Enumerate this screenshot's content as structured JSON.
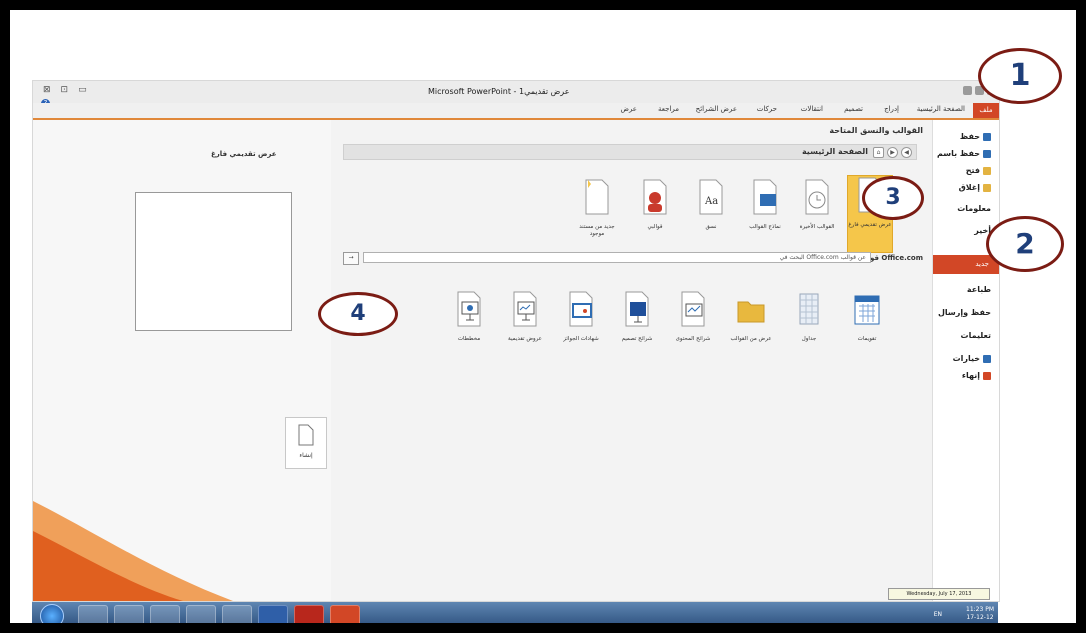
{
  "window": {
    "title": "Microsoft PowerPoint - عرض تقديمي1",
    "help_glyph": "?",
    "tabs": [
      "ملف",
      "الصفحة الرئيسية",
      "إدراج",
      "تصميم",
      "انتقالات",
      "حركات",
      "عرض الشرائح",
      "مراجعة",
      "عرض"
    ]
  },
  "backstage_nav": {
    "items": [
      {
        "label": "حفظ",
        "icon": "save-icon",
        "color": "#2f6db3"
      },
      {
        "label": "حفظ باسم",
        "icon": "save-as-icon",
        "color": "#2f6db3"
      },
      {
        "label": "فتح",
        "icon": "open-folder-icon",
        "color": "#e3b341"
      },
      {
        "label": "إغلاق",
        "icon": "close-file-icon",
        "color": "#e3b341"
      },
      {
        "label": "معلومات",
        "icon": "",
        "color": ""
      },
      {
        "label": "أخير",
        "icon": "",
        "color": ""
      },
      {
        "label": "جديد",
        "icon": "",
        "color": "#d24726"
      },
      {
        "label": "طباعة",
        "icon": "",
        "color": ""
      },
      {
        "label": "حفظ وإرسال",
        "icon": "",
        "color": ""
      },
      {
        "label": "تعليمات",
        "icon": "",
        "color": ""
      },
      {
        "label": "خيارات",
        "icon": "options-icon",
        "color": "#2f6db3"
      },
      {
        "label": "إنهاء",
        "icon": "exit-icon",
        "color": "#d24726"
      }
    ]
  },
  "center": {
    "title": "القوالب والنسق المتاحة",
    "home_label": "الصفحة الرئيسية",
    "templates": [
      {
        "label": "عرض تقديمي فارغ",
        "selected": true
      },
      {
        "label": "القوالب الأخيرة",
        "selected": false
      },
      {
        "label": "نماذج القوالب",
        "selected": false
      },
      {
        "label": "نسق",
        "selected": false
      },
      {
        "label": "قوالبي",
        "selected": false
      },
      {
        "label": "جديد من مستند موجود",
        "selected": false
      }
    ],
    "office_label": "قوالب Office.com",
    "search_placeholder": "البحث في Office.com عن قوالب",
    "search_button": "→",
    "office_templates": [
      {
        "label": "تقويمات"
      },
      {
        "label": "جداول"
      },
      {
        "label": "عرض من القوالب"
      },
      {
        "label": "شرائح المحتوى"
      },
      {
        "label": "شرائح تصميم"
      },
      {
        "label": "شهادات الجوائز"
      },
      {
        "label": "عروض تقديمية"
      },
      {
        "label": "مخططات"
      }
    ]
  },
  "preview": {
    "title": "عرض تقديمي فارغ",
    "create_label": "إنشاء"
  },
  "taskbar": {
    "apps": [
      "start",
      "explorer",
      "media-player",
      "internet-explorer",
      "firefox",
      "chrome",
      "word",
      "acrobat",
      "powerpoint"
    ],
    "lang": "EN",
    "time": "11:23 PM",
    "date": "17-12-12",
    "date_tooltip": "Wednesday, July 17, 2013"
  },
  "callouts": [
    "1",
    "2",
    "3",
    "4"
  ],
  "colors": {
    "accent": "#d24726",
    "selected_tile": "#f5c64a",
    "callout_border": "#7b1c14",
    "callout_text": "#1f3f7a"
  }
}
